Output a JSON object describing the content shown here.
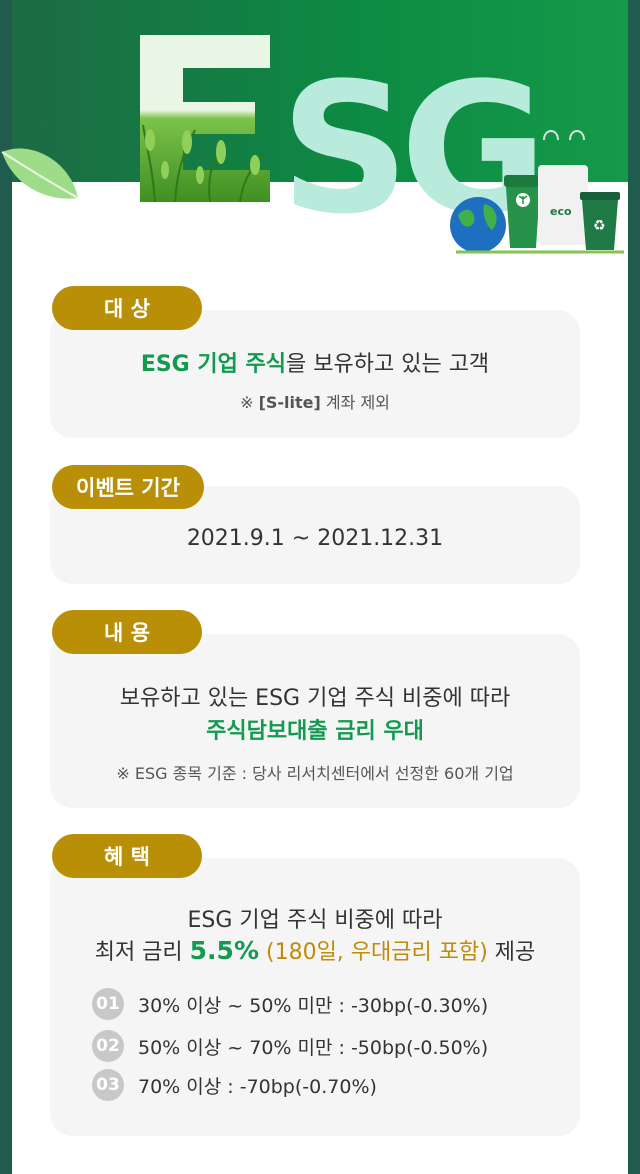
{
  "hero": {
    "letters": [
      "E",
      "S",
      "G"
    ],
    "eco_label": "eco"
  },
  "sections": [
    {
      "pill": "대 상",
      "main_bold": "ESG 기업 주식",
      "main_rest": "을 보유하고 있는 고객",
      "note_prefix": "※ ",
      "note_code": "[S-lite]",
      "note_rest": " 계좌 제외"
    },
    {
      "pill": "이벤트 기간",
      "period": "2021.9.1 ~ 2021.12.31"
    },
    {
      "pill": "내 용",
      "line1": "보유하고 있는 ESG 기업 주식 비중에 따라",
      "line2": "주식담보대출 금리 우대",
      "note": "※ ESG 종목 기준 : 당사 리서치센터에서 선정한 60개 기업"
    },
    {
      "pill": "혜 택",
      "line1": "ESG 기업 주식 비중에 따라",
      "line2_pre": "최저 금리 ",
      "line2_rate": "5.5%",
      "line2_paren": " (180일, 우대금리 포함)",
      "line2_post": " 제공",
      "tiers": [
        {
          "num": "01",
          "text": "30% 이상 ~ 50% 미만  :  -30bp(-0.30%)"
        },
        {
          "num": "02",
          "text": "50% 이상 ~ 70% 미만  :  -50bp(-0.50%)"
        },
        {
          "num": "03",
          "text": "70% 이상  :  -70bp(-0.70%)"
        }
      ]
    }
  ],
  "colors": {
    "pill": "#b88f07",
    "accent_green": "#119a50",
    "accent_amber": "#c08c08",
    "card": "#f5f5f5",
    "frame": "#1f5c4d"
  }
}
